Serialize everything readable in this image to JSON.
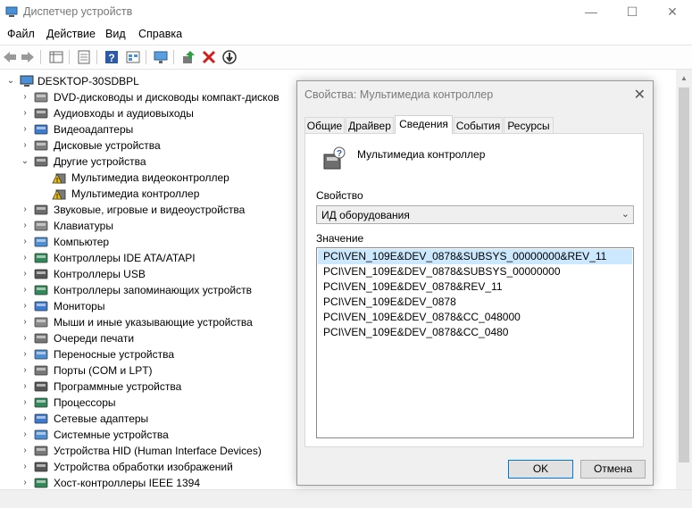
{
  "window": {
    "title": "Диспетчер устройств",
    "min_label": "—",
    "max_label": "☐",
    "close_label": "✕"
  },
  "menu": [
    "Файл",
    "Действие",
    "Вид",
    "Справка"
  ],
  "tree": {
    "root": "DESKTOP-30SDBPL",
    "items": [
      {
        "label": "DVD-дисководы и дисководы компакт-дисков",
        "icon": "dvd-drive-icon"
      },
      {
        "label": "Аудиовходы и аудиовыходы",
        "icon": "audio-io-icon"
      },
      {
        "label": "Видеоадаптеры",
        "icon": "display-adapter-icon"
      },
      {
        "label": "Дисковые устройства",
        "icon": "disk-drive-icon"
      },
      {
        "label": "Другие устройства",
        "icon": "other-device-icon",
        "expanded": true
      },
      {
        "label": "Мультимедиа видеоконтроллер",
        "icon": "warning-device-icon",
        "child": true
      },
      {
        "label": "Мультимедиа контроллер",
        "icon": "warning-device-icon",
        "child": true
      },
      {
        "label": "Звуковые, игровые и видеоустройства",
        "icon": "sound-icon"
      },
      {
        "label": "Клавиатуры",
        "icon": "keyboard-icon"
      },
      {
        "label": "Компьютер",
        "icon": "computer-icon"
      },
      {
        "label": "Контроллеры IDE ATA/ATAPI",
        "icon": "ide-controller-icon"
      },
      {
        "label": "Контроллеры USB",
        "icon": "usb-icon"
      },
      {
        "label": "Контроллеры запоминающих устройств",
        "icon": "storage-controller-icon"
      },
      {
        "label": "Мониторы",
        "icon": "monitor-icon"
      },
      {
        "label": "Мыши и иные указывающие устройства",
        "icon": "mouse-icon"
      },
      {
        "label": "Очереди печати",
        "icon": "printer-icon"
      },
      {
        "label": "Переносные устройства",
        "icon": "portable-device-icon"
      },
      {
        "label": "Порты (COM и LPT)",
        "icon": "port-icon"
      },
      {
        "label": "Программные устройства",
        "icon": "software-device-icon"
      },
      {
        "label": "Процессоры",
        "icon": "processor-icon"
      },
      {
        "label": "Сетевые адаптеры",
        "icon": "network-adapter-icon"
      },
      {
        "label": "Системные устройства",
        "icon": "system-device-icon"
      },
      {
        "label": "Устройства HID (Human Interface Devices)",
        "icon": "hid-icon"
      },
      {
        "label": "Устройства обработки изображений",
        "icon": "camera-icon"
      },
      {
        "label": "Хост-контроллеры IEEE 1394",
        "icon": "ieee1394-icon"
      }
    ]
  },
  "dialog": {
    "title": "Свойства: Мультимедиа контроллер",
    "close_label": "✕",
    "tabs": [
      "Общие",
      "Драйвер",
      "Сведения",
      "События",
      "Ресурсы"
    ],
    "active_tab": "Сведения",
    "device_name": "Мультимедиа контроллер",
    "property_label": "Свойство",
    "property_value": "ИД оборудования",
    "value_label": "Значение",
    "values": [
      "PCI\\VEN_109E&DEV_0878&SUBSYS_00000000&REV_11",
      "PCI\\VEN_109E&DEV_0878&SUBSYS_00000000",
      "PCI\\VEN_109E&DEV_0878&REV_11",
      "PCI\\VEN_109E&DEV_0878",
      "PCI\\VEN_109E&DEV_0878&CC_048000",
      "PCI\\VEN_109E&DEV_0878&CC_0480"
    ],
    "ok_label": "OK",
    "cancel_label": "Отмена"
  },
  "colors": {
    "accent": "#0078d7",
    "selection": "#cce8ff",
    "warning": "#f0c000"
  }
}
